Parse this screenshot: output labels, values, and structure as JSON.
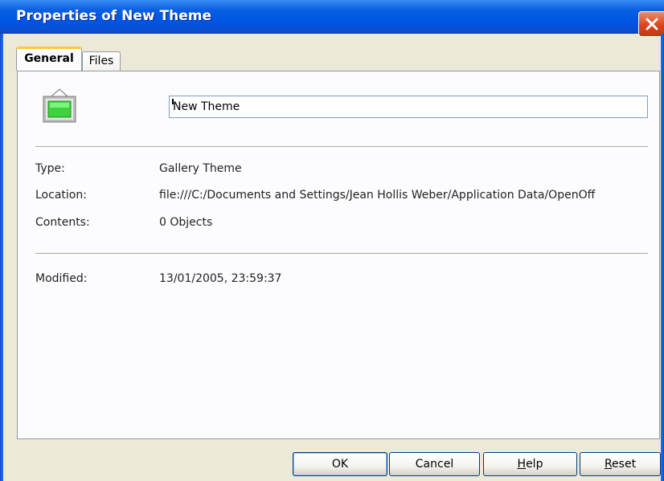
{
  "window": {
    "title": "Properties of New Theme"
  },
  "tabs": [
    {
      "label": "General",
      "active": true
    },
    {
      "label": "Files",
      "active": false
    }
  ],
  "general": {
    "name_value": "New Theme",
    "icon": "gallery-theme-icon",
    "fields": [
      {
        "label": "Type:",
        "value": "Gallery Theme"
      },
      {
        "label": "Location:",
        "value": "file:///C:/Documents and Settings/Jean Hollis Weber/Application Data/OpenOff"
      },
      {
        "label": "Contents:",
        "value": "0 Objects"
      }
    ],
    "modified": {
      "label": "Modified:",
      "value": "13/01/2005, 23:59:37"
    }
  },
  "buttons": {
    "ok": "OK",
    "cancel": "Cancel",
    "help_mnemonic": "H",
    "help_rest": "elp",
    "reset_mnemonic": "R",
    "reset_rest": "eset"
  },
  "colors": {
    "titlebar": "#0055e5",
    "close_button": "#d8401a",
    "dialog_face": "#ece9d8",
    "active_tab_highlight": "#ffc83c"
  }
}
